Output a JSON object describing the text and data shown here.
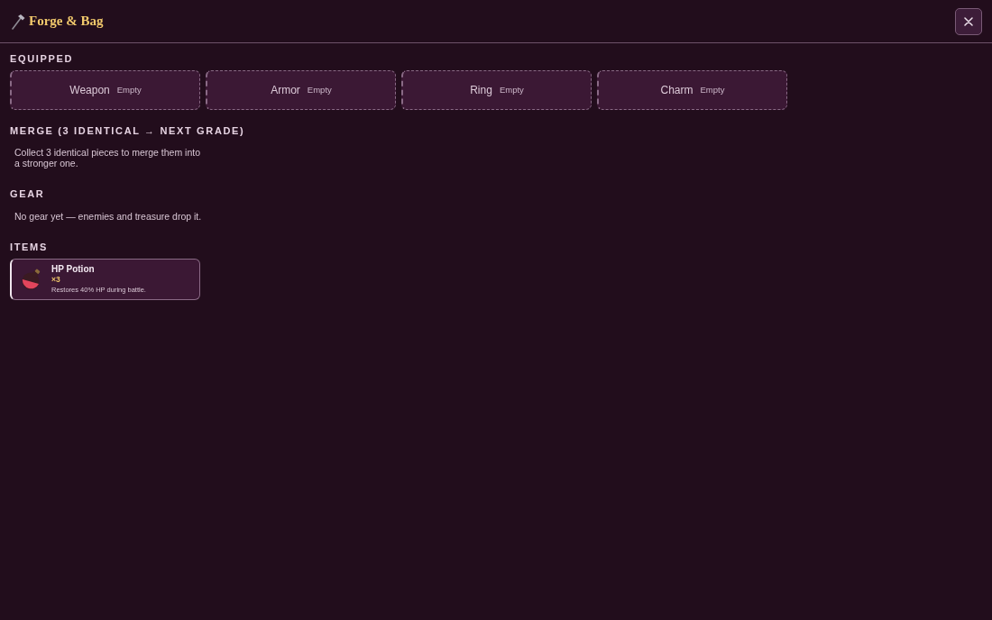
{
  "header": {
    "title": "Forge & Bag"
  },
  "equipped": {
    "label": "EQUIPPED",
    "slots": [
      {
        "name": "Weapon",
        "status": "Empty"
      },
      {
        "name": "Armor",
        "status": "Empty"
      },
      {
        "name": "Ring",
        "status": "Empty"
      },
      {
        "name": "Charm",
        "status": "Empty"
      }
    ]
  },
  "merge": {
    "label": "MERGE (3 IDENTICAL → NEXT GRADE)",
    "text": "Collect 3 identical pieces to merge them into a stronger one."
  },
  "gear": {
    "label": "GEAR",
    "text": "No gear yet — enemies and treasure drop it."
  },
  "items": {
    "label": "ITEMS",
    "list": [
      {
        "kind": "potion",
        "name": "HP Potion",
        "count": "×3",
        "description": "Restores 40% HP during battle."
      }
    ]
  }
}
